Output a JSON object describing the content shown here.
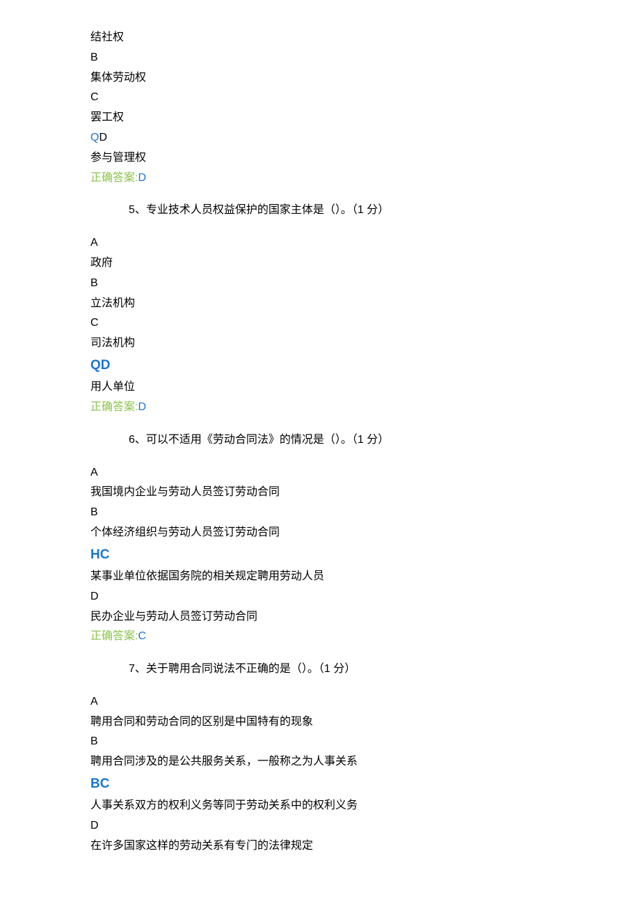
{
  "q4_tail": {
    "opt_a_text": "结社权",
    "opt_b_letter": "B",
    "opt_b_text": "集体劳动权",
    "opt_c_letter": "C",
    "opt_c_text": "罢工权",
    "opt_d_marker_q": "Q",
    "opt_d_marker_d": "D",
    "opt_d_text": "参与管理权",
    "answer_label": "正确答案:",
    "answer_value": "D"
  },
  "q5": {
    "heading": "5、专业技术人员权益保护的国家主体是（）。（1 分）",
    "opt_a_letter": "A",
    "opt_a_text": "政府",
    "opt_b_letter": "B",
    "opt_b_text": "立法机构",
    "opt_c_letter": "C",
    "opt_c_text": "司法机构",
    "opt_d_marker_q": "Q",
    "opt_d_marker_d": "D",
    "opt_d_text": "用人单位",
    "answer_label": "正确答案:",
    "answer_value": "D"
  },
  "q6": {
    "heading": "6、可以不适用《劳动合同法》的情况是（）。（1 分）",
    "opt_a_letter": "A",
    "opt_a_text": "我国境内企业与劳动人员签订劳动合同",
    "opt_b_letter": "B",
    "opt_b_text": "个体经济组织与劳动人员签订劳动合同",
    "opt_c_marker_h": "H",
    "opt_c_marker_c": "C",
    "opt_c_text": "某事业单位依据国务院的相关规定聘用劳动人员",
    "opt_d_letter": "D",
    "opt_d_text": "民办企业与劳动人员签订劳动合同",
    "answer_label": "正确答案:",
    "answer_value": "C"
  },
  "q7": {
    "heading": "7、关于聘用合同说法不正确的是（）。（1 分）",
    "opt_a_letter": "A",
    "opt_a_text": "聘用合同和劳动合同的区别是中国特有的现象",
    "opt_b_letter": "B",
    "opt_b_text": "聘用合同涉及的是公共服务关系，一般称之为人事关系",
    "opt_c_marker_b": "B",
    "opt_c_marker_c": "C",
    "opt_c_text": "人事关系双方的权利义务等同于劳动关系中的权利义务",
    "opt_d_letter": "D",
    "opt_d_text": "在许多国家这样的劳动关系有专门的法律规定"
  }
}
